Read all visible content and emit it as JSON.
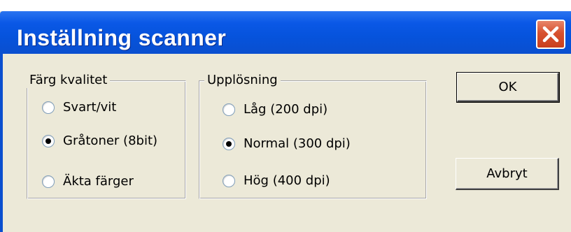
{
  "window": {
    "title": "Inställning scanner",
    "close_icon": "close-x-icon",
    "colors": {
      "titlebar": "#0653dc",
      "close_button": "#d7512f",
      "face": "#ece9d8"
    }
  },
  "color_quality": {
    "legend": "Färg kvalitet",
    "options": [
      {
        "label": "Svart/vit",
        "checked": false
      },
      {
        "label": "Gråtoner (8bit)",
        "checked": true
      },
      {
        "label": "Äkta färger",
        "checked": false
      }
    ]
  },
  "resolution": {
    "legend": "Upplösning",
    "options": [
      {
        "label": "Låg (200 dpi)",
        "checked": false
      },
      {
        "label": "Normal (300 dpi)",
        "checked": true
      },
      {
        "label": "Hög (400 dpi)",
        "checked": false
      }
    ]
  },
  "buttons": {
    "ok_label": "OK",
    "cancel_label": "Avbryt"
  }
}
